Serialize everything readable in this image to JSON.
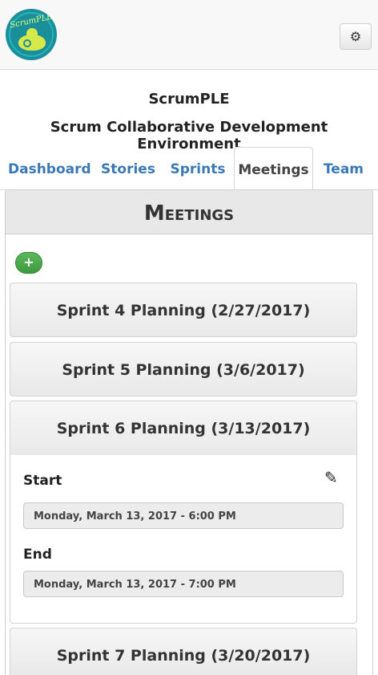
{
  "header": {
    "logo_text": "ScrumPLE",
    "settings_icon": "gear-icon"
  },
  "app": {
    "title": "ScrumPLE",
    "subtitle": "Scrum Collaborative Development Environment"
  },
  "tabs": [
    {
      "label": "Dashboard",
      "active": false
    },
    {
      "label": "Stories",
      "active": false
    },
    {
      "label": "Sprints",
      "active": false
    },
    {
      "label": "Meetings",
      "active": true
    },
    {
      "label": "Team",
      "active": false
    }
  ],
  "panel": {
    "title": "Meetings",
    "add_label": "+"
  },
  "meetings": [
    {
      "title": "Sprint 4 Planning (2/27/2017)"
    },
    {
      "title": "Sprint 5 Planning (3/6/2017)"
    },
    {
      "title": "Sprint 6 Planning (3/13/2017)",
      "expanded": true
    },
    {
      "title": "Sprint 7 Planning (3/20/2017)"
    }
  ],
  "detail": {
    "start_label": "Start",
    "start_value": "Monday, March 13, 2017 - 6:00 PM",
    "end_label": "End",
    "end_value": "Monday, March 13, 2017 - 7:00 PM",
    "edit_icon": "pencil-icon"
  },
  "colors": {
    "link": "#3a79b5",
    "add_button": "#4cae4c",
    "panel_header": "#e8e8e8"
  }
}
